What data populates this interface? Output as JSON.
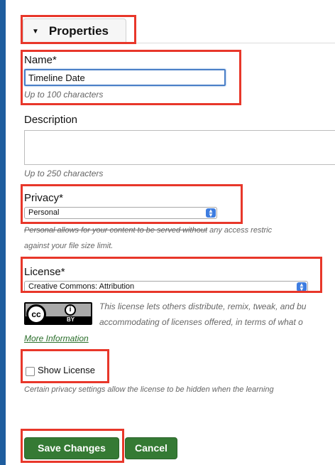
{
  "tab": {
    "caret": "▼",
    "label": "Properties"
  },
  "name": {
    "label": "Name*",
    "value": "Timeline Date",
    "hint": "Up to 100 characters"
  },
  "description": {
    "label": "Description",
    "hint": "Up to 250 characters"
  },
  "privacy": {
    "label": "Privacy*",
    "selected": "Personal",
    "help_struck": "Personal allows for your content to be served without",
    "help_rest": " any access restric",
    "help_line2": "against your file size limit."
  },
  "license": {
    "label": "License*",
    "selected": "Creative Commons: Attribution",
    "badge": {
      "cc": "cc",
      "by": "BY"
    },
    "desc_line1": "This license lets others distribute, remix, tweak, and bu",
    "desc_line2": "accommodating of licenses offered, in terms of what o",
    "more_info": "More Information"
  },
  "show_license": {
    "label": "Show License",
    "checked": false,
    "hint": "Certain privacy settings allow the license to be hidden when the learning"
  },
  "actions": {
    "save": "Save Changes",
    "cancel": "Cancel"
  },
  "colors": {
    "accent": "#1e5d9e",
    "highlight": "#e8372a",
    "button": "#357a34",
    "link": "#2a6e2a"
  }
}
